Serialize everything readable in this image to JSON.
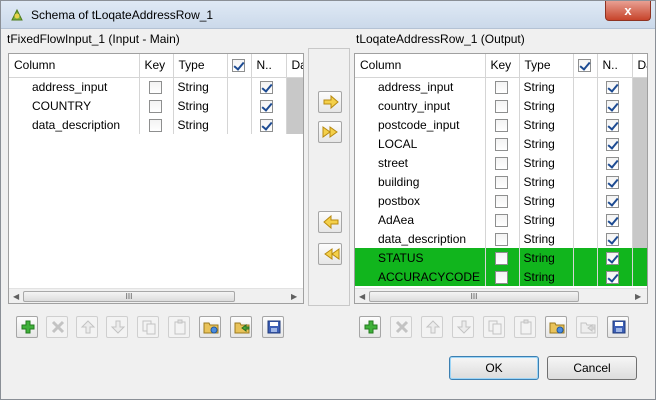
{
  "window": {
    "title": "Schema of tLoqateAddressRow_1",
    "close_label": "x"
  },
  "left": {
    "label": "tFixedFlowInput_1 (Input - Main)",
    "headers": [
      "Column",
      "Key",
      "Type",
      "",
      "N..",
      "Da"
    ],
    "rows": [
      {
        "name": "address_input",
        "key": false,
        "type": "String",
        "nullable": true
      },
      {
        "name": "COUNTRY",
        "key": false,
        "type": "String",
        "nullable": true
      },
      {
        "name": "data_description",
        "key": false,
        "type": "String",
        "nullable": true
      }
    ]
  },
  "right": {
    "label": "tLoqateAddressRow_1 (Output)",
    "headers": [
      "Column",
      "Key",
      "Type",
      "",
      "N..",
      "Da"
    ],
    "rows": [
      {
        "name": "address_input",
        "key": false,
        "type": "String",
        "nullable": true,
        "highlight": false
      },
      {
        "name": "country_input",
        "key": false,
        "type": "String",
        "nullable": true,
        "highlight": false
      },
      {
        "name": "postcode_input",
        "key": false,
        "type": "String",
        "nullable": true,
        "highlight": false
      },
      {
        "name": "LOCAL",
        "key": false,
        "type": "String",
        "nullable": true,
        "highlight": false
      },
      {
        "name": "street",
        "key": false,
        "type": "String",
        "nullable": true,
        "highlight": false
      },
      {
        "name": "building",
        "key": false,
        "type": "String",
        "nullable": true,
        "highlight": false
      },
      {
        "name": "postbox",
        "key": false,
        "type": "String",
        "nullable": true,
        "highlight": false
      },
      {
        "name": "AdAea",
        "key": false,
        "type": "String",
        "nullable": true,
        "highlight": false
      },
      {
        "name": "data_description",
        "key": false,
        "type": "String",
        "nullable": true,
        "highlight": false
      },
      {
        "name": "STATUS",
        "key": false,
        "type": "String",
        "nullable": true,
        "highlight": true
      },
      {
        "name": "ACCURACYCODE",
        "key": false,
        "type": "String",
        "nullable": true,
        "highlight": true
      }
    ]
  },
  "scrollbar_thumb_label": "III",
  "colors": {
    "highlight": "#11b51d",
    "accent": "#1d4b92"
  },
  "buttons": {
    "ok": "OK",
    "cancel": "Cancel"
  }
}
